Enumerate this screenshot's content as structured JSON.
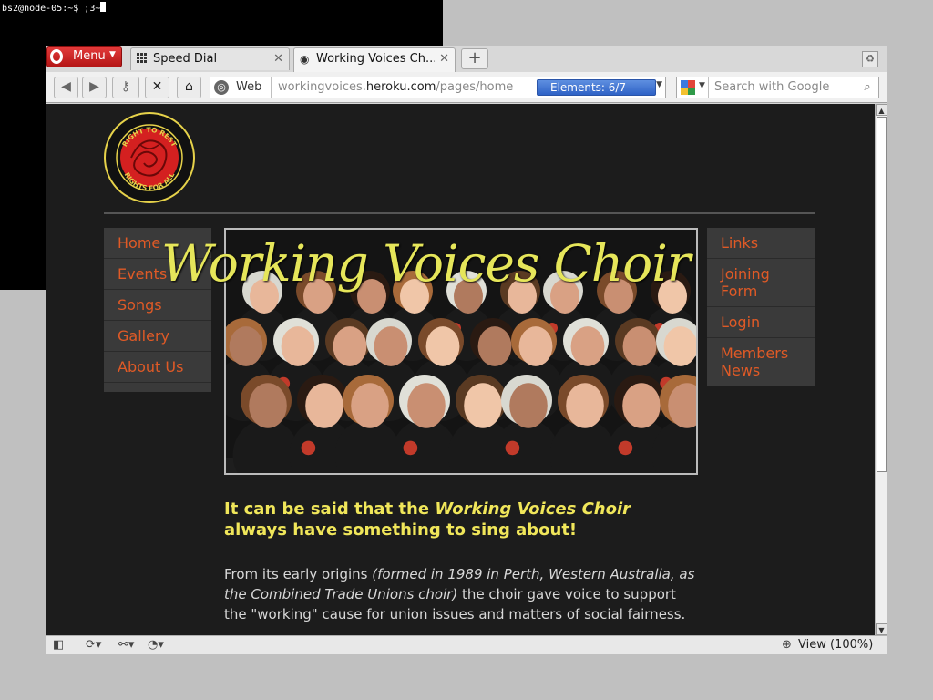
{
  "terminal": {
    "prompt": "bs2@node-05:~$ ;3~"
  },
  "browser": {
    "menu_label": "Menu",
    "tabs": [
      {
        "label": "Speed Dial"
      },
      {
        "label": "Working Voices Ch..."
      }
    ],
    "address": {
      "site_label": "Web",
      "url_prefix": "workingvoices.",
      "url_domain": "heroku.com",
      "url_path": "/pages/home",
      "elements_label": "Elements:   6/7"
    },
    "search": {
      "placeholder": "Search with Google"
    },
    "status": {
      "zoom_label": "View (100%)"
    }
  },
  "page": {
    "hero_title": "Working Voices Choir",
    "nav_left": [
      "Home",
      "Events",
      "Songs",
      "Gallery",
      "About Us"
    ],
    "nav_right": [
      "Links",
      "Joining Form",
      "Login",
      "Members News"
    ],
    "lead_prefix": "It can be said that the ",
    "lead_em": "Working Voices Choir",
    "lead_suffix": " always have something to sing about!",
    "para_start": "From its early origins ",
    "para_em": "(formed in 1989 in Perth, Western Australia, as the Combined Trade Unions choir)",
    "para_end": " the choir gave voice to support the \"working\" cause for union issues and matters of social fairness.",
    "logo_text_top": "RIGHT TO REST",
    "logo_text_left": "RIGHT TO WORK",
    "logo_text_right": "RIGHT TO PLAY",
    "logo_text_bottom": "RIGHTS FOR ALL"
  }
}
